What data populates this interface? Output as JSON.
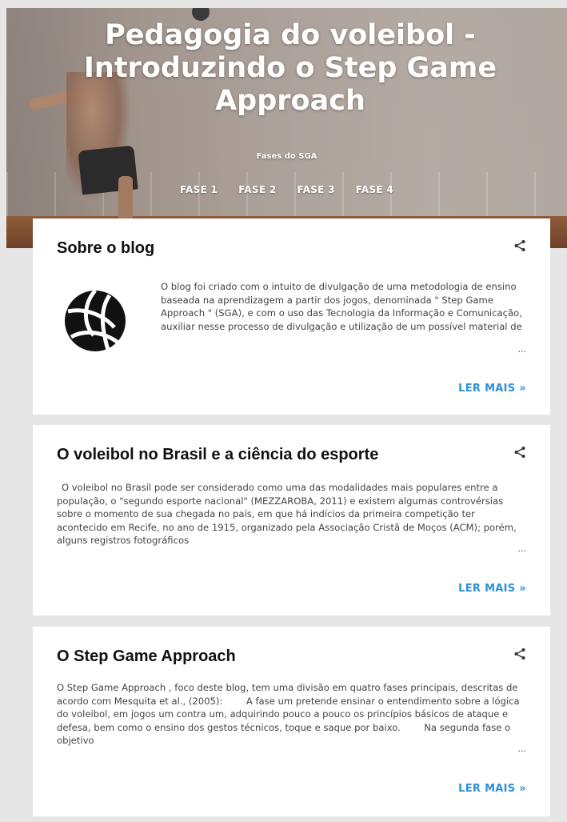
{
  "blog": {
    "title": "Pedagogia do voleibol - Introduzindo o Step Game Approach",
    "subtitle": "Fases do SGA",
    "nav": [
      {
        "label": "FASE 1"
      },
      {
        "label": "FASE 2"
      },
      {
        "label": "FASE 3"
      },
      {
        "label": "FASE 4"
      }
    ]
  },
  "posts": [
    {
      "title": "Sobre o blog",
      "snippet": "O blog foi criado com o intuito de divulgação de uma metodologia de ensino baseada na aprendizagem a partir dos jogos, denominada \" Step Game Approach \" (SGA), e com o uso das Tecnologia da Informação e Comunicação, auxiliar nesse processo de divulgação e utilização de um possível material de",
      "read_more": "LER MAIS »",
      "ellipsis": "..."
    },
    {
      "title": "O voleibol no Brasil e a ciência do esporte",
      "snippet": "O voleibol no Brasil pode ser considerado como uma das modalidades mais populares entre a população, o \"segundo esporte nacional\" (MEZZAROBA, 2011) e existem algumas controvérsias sobre o momento de sua chegada no país, em que há indícios da primeira competição ter acontecido em Recife, no ano de 1915, organizado pela Associação Cristã de Moços (ACM); porém, alguns registros fotográficos",
      "read_more": "LER MAIS »",
      "ellipsis": "..."
    },
    {
      "title": "O Step Game Approach",
      "snippet": "O Step Game Approach , foco deste blog, tem uma divisão em quatro fases principais, descritas de acordo com Mesquita et al., (2005):        A fase um pretende ensinar o entendimento sobre a lógica do voleibol, em jogos um contra um, adquirindo pouco a pouco os princípios básicos de ataque e defesa, bem como o ensino dos gestos técnicos, toque e saque por baixo.        Na segunda fase o objetivo",
      "read_more": "LER MAIS »",
      "ellipsis": "..."
    }
  ],
  "colors": {
    "accent": "#2f8fd6",
    "page_bg": "#e6e6e6",
    "card_bg": "#ffffff"
  },
  "icons": {
    "share": "share-icon",
    "thumbnail": "volleyball-icon"
  }
}
